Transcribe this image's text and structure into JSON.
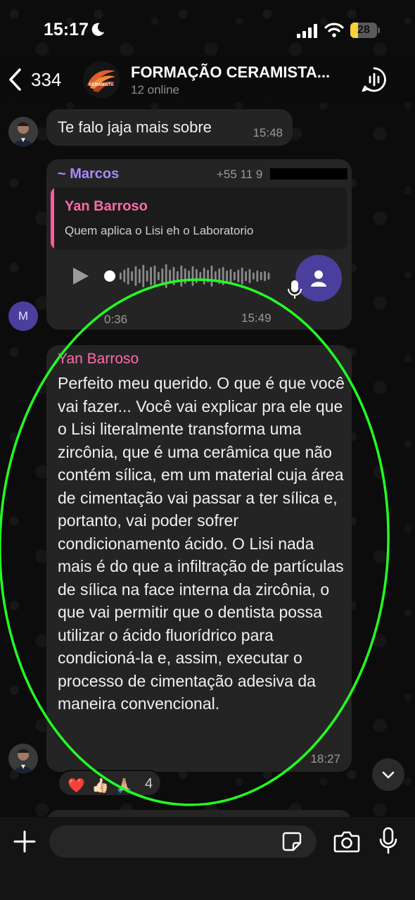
{
  "status_bar": {
    "time": "15:17",
    "battery_level": "28",
    "battery_fraction": 0.28,
    "icons": [
      "moon-icon",
      "signal-icon",
      "wifi-icon",
      "battery-icon"
    ]
  },
  "header": {
    "back_count": "334",
    "group_name": "FORMAÇÃO CERAMISTA...",
    "subtitle": "12 online",
    "avatar_logo_text": "CERAMISTA"
  },
  "messages": [
    {
      "text": "Te falo jaja mais sobre",
      "time": "15:48"
    },
    {
      "sender": "~ Marcos",
      "phone": "+55 11 9",
      "avatar_initial": "M",
      "quote": {
        "name": "Yan Barroso",
        "text": "Quem aplica o Lisi eh o Laboratorio"
      },
      "duration": "0:36",
      "time": "15:49"
    },
    {
      "sender": "Yan Barroso",
      "text": "Perfeito meu querido. O que é que você vai fazer... Você vai explicar pra ele que o Lisi literalmente transforma uma zircônia, que é uma cerâmica que não contém sílica, em um material cuja área de cimentação vai passar a ter sílica e, portanto, vai poder sofrer condicionamento ácido. O Lisi nada mais é do que a infiltração de partículas de sílica na face interna da zircônia, o que vai permitir que o dentista possa utilizar o ácido fluorídrico para condicioná-la e, assim, executar o processo de cimentação adesiva da maneira convencional.",
      "time": "18:27",
      "reactions": {
        "emojis": [
          "❤️",
          "👍🏻",
          "🙏🏼"
        ],
        "count": "4"
      }
    }
  ],
  "input": {
    "placeholder": "",
    "value": ""
  },
  "colors": {
    "accent_marcos": "#a88aff",
    "accent_yan": "#ff6ba9",
    "highlight_ellipse": "#22ff22",
    "bubble": "#242424"
  }
}
